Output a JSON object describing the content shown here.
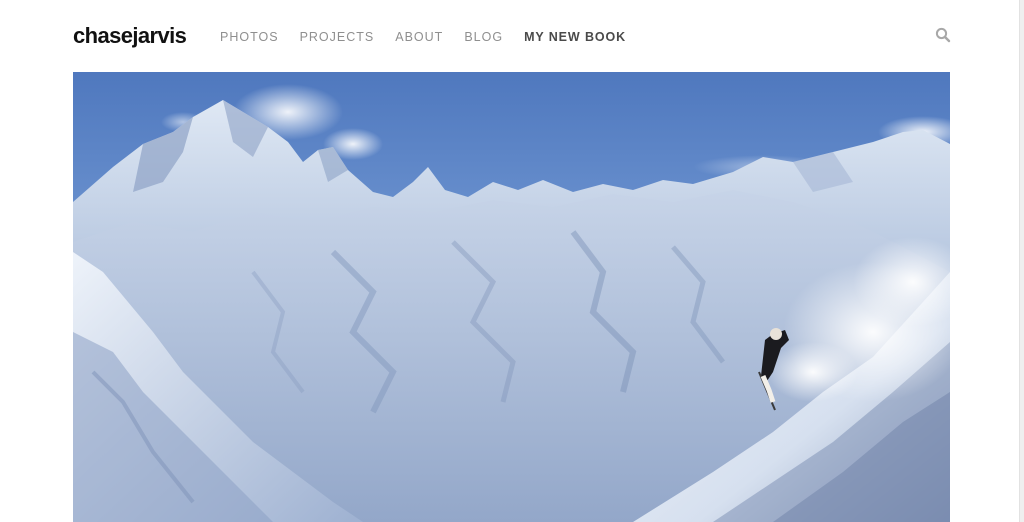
{
  "brand": {
    "logo_text": "chasejarvis"
  },
  "nav": {
    "items": [
      {
        "label": "PHOTOS",
        "active": false
      },
      {
        "label": "PROJECTS",
        "active": false
      },
      {
        "label": "ABOUT",
        "active": false
      },
      {
        "label": "BLOG",
        "active": false
      },
      {
        "label": "MY NEW BOOK",
        "active": true
      }
    ]
  },
  "search": {
    "icon": "search-icon"
  },
  "hero": {
    "subject": "snowy-mountains-skier"
  },
  "colors": {
    "logo": "#111111",
    "nav_text": "#8f8f8f",
    "nav_active": "#4a4a4a",
    "search_icon": "#a8a8a8",
    "sky": "#5f86c8",
    "snow": "#e6edf6",
    "shadow": "#7e92b8"
  }
}
